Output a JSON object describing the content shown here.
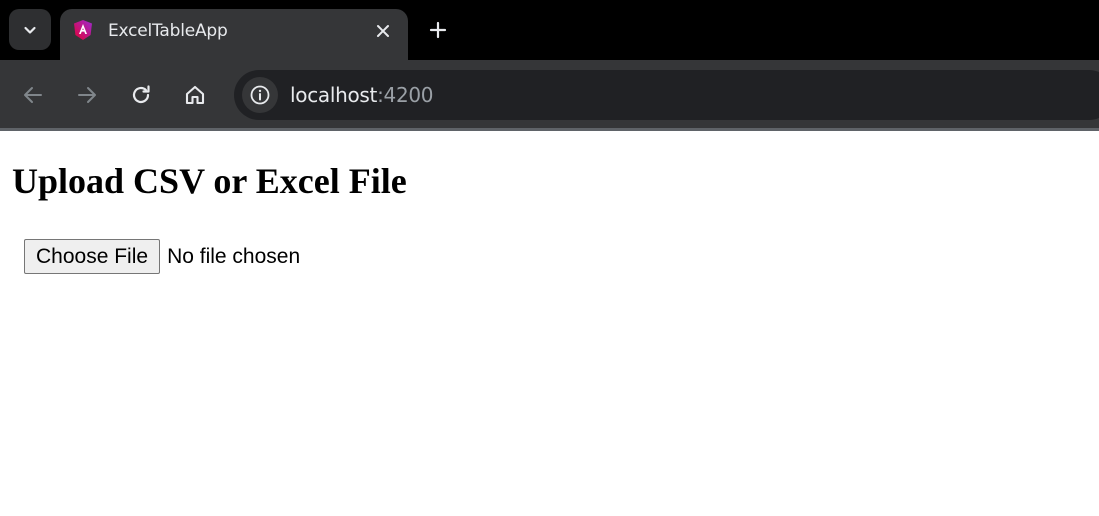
{
  "browser": {
    "tab": {
      "title": "ExcelTableApp",
      "favicon": "angular-logo-icon"
    },
    "address_bar": {
      "host": "localhost",
      "port": ":4200"
    },
    "colors": {
      "tabstrip": "#000000",
      "toolbar": "#353638",
      "omnibox": "#202124",
      "favicon_gradient_start": "#e40035",
      "favicon_gradient_end": "#9c2bd1"
    }
  },
  "page": {
    "title": "Upload CSV or Excel File",
    "file_input": {
      "button_label": "Choose File",
      "status": "No file chosen"
    }
  }
}
